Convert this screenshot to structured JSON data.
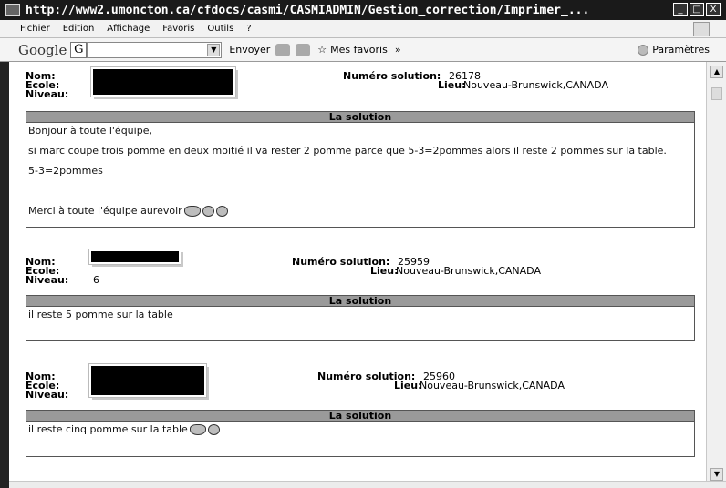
{
  "window": {
    "title": "http://www2.umoncton.ca/cfdocs/casmi/CASMIADMIN/Gestion_correction/Imprimer_...",
    "buttons": [
      "_",
      "□",
      "X"
    ]
  },
  "menu": {
    "items": [
      "Fichier",
      "Edition",
      "Affichage",
      "Favoris",
      "Outils",
      "?"
    ]
  },
  "toolbar": {
    "google_label": "Google",
    "google_box": "G",
    "send_label": "Envoyer",
    "favorites_label": "Mes favoris",
    "more_label": "»",
    "settings_label": "Paramètres"
  },
  "records": [
    {
      "nom_label": "Nom:",
      "ecole_label": "Ecole:",
      "niveau_label": "Niveau:",
      "niveau_value": "",
      "solution_label": "Numéro solution:",
      "solution_number": "26178",
      "lieu_label": "Lieu:",
      "lieu_value": "Nouveau-Brunswick,CANADA",
      "solution_header": "La solution",
      "lines": [
        "Bonjour à toute l'équipe,",
        "si marc  coupe trois pomme en deux moitié il va rester 2 pomme parce que 5-3=2pommes  alors il reste 2 pommes  sur la table.",
        "5-3=2pommes",
        "Merci à toute l'équipe aurevoir"
      ]
    },
    {
      "nom_label": "Nom:",
      "ecole_label": "Ecole:",
      "niveau_label": "Niveau:",
      "niveau_value": "6",
      "solution_label": "Numéro solution:",
      "solution_number": "25959",
      "lieu_label": "Lieu:",
      "lieu_value": "Nouveau-Brunswick,CANADA",
      "solution_header": "La solution",
      "lines": [
        "il reste 5 pomme sur la table"
      ]
    },
    {
      "nom_label": "Nom:",
      "ecole_label": "Ecole:",
      "niveau_label": "Niveau:",
      "niveau_value": "",
      "solution_label": "Numéro solution:",
      "solution_number": "25960",
      "lieu_label": "Lieu:",
      "lieu_value": "Nouveau-Brunswick,CANADA",
      "solution_header": "La solution",
      "lines": [
        "il reste cinq pomme sur la table"
      ]
    }
  ]
}
